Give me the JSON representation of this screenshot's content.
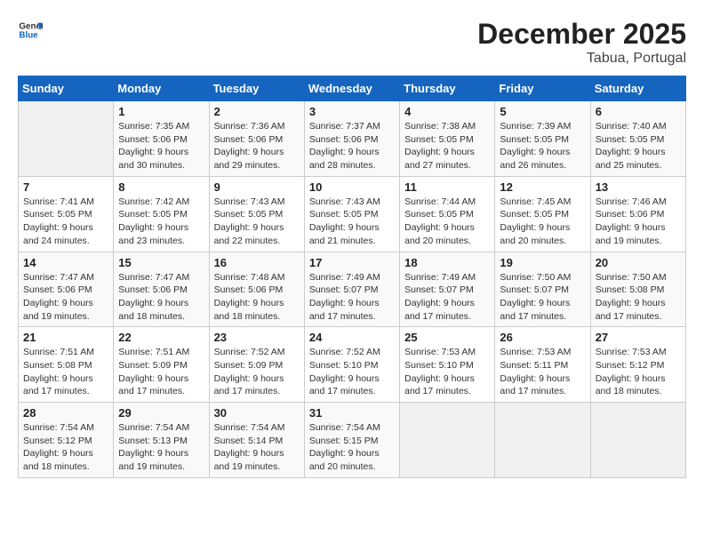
{
  "header": {
    "logo_line1": "General",
    "logo_line2": "Blue",
    "month": "December 2025",
    "location": "Tabua, Portugal"
  },
  "days_of_week": [
    "Sunday",
    "Monday",
    "Tuesday",
    "Wednesday",
    "Thursday",
    "Friday",
    "Saturday"
  ],
  "weeks": [
    [
      {
        "day": "",
        "info": ""
      },
      {
        "day": "1",
        "info": "Sunrise: 7:35 AM\nSunset: 5:06 PM\nDaylight: 9 hours\nand 30 minutes."
      },
      {
        "day": "2",
        "info": "Sunrise: 7:36 AM\nSunset: 5:06 PM\nDaylight: 9 hours\nand 29 minutes."
      },
      {
        "day": "3",
        "info": "Sunrise: 7:37 AM\nSunset: 5:06 PM\nDaylight: 9 hours\nand 28 minutes."
      },
      {
        "day": "4",
        "info": "Sunrise: 7:38 AM\nSunset: 5:05 PM\nDaylight: 9 hours\nand 27 minutes."
      },
      {
        "day": "5",
        "info": "Sunrise: 7:39 AM\nSunset: 5:05 PM\nDaylight: 9 hours\nand 26 minutes."
      },
      {
        "day": "6",
        "info": "Sunrise: 7:40 AM\nSunset: 5:05 PM\nDaylight: 9 hours\nand 25 minutes."
      }
    ],
    [
      {
        "day": "7",
        "info": "Sunrise: 7:41 AM\nSunset: 5:05 PM\nDaylight: 9 hours\nand 24 minutes."
      },
      {
        "day": "8",
        "info": "Sunrise: 7:42 AM\nSunset: 5:05 PM\nDaylight: 9 hours\nand 23 minutes."
      },
      {
        "day": "9",
        "info": "Sunrise: 7:43 AM\nSunset: 5:05 PM\nDaylight: 9 hours\nand 22 minutes."
      },
      {
        "day": "10",
        "info": "Sunrise: 7:43 AM\nSunset: 5:05 PM\nDaylight: 9 hours\nand 21 minutes."
      },
      {
        "day": "11",
        "info": "Sunrise: 7:44 AM\nSunset: 5:05 PM\nDaylight: 9 hours\nand 20 minutes."
      },
      {
        "day": "12",
        "info": "Sunrise: 7:45 AM\nSunset: 5:05 PM\nDaylight: 9 hours\nand 20 minutes."
      },
      {
        "day": "13",
        "info": "Sunrise: 7:46 AM\nSunset: 5:06 PM\nDaylight: 9 hours\nand 19 minutes."
      }
    ],
    [
      {
        "day": "14",
        "info": "Sunrise: 7:47 AM\nSunset: 5:06 PM\nDaylight: 9 hours\nand 19 minutes."
      },
      {
        "day": "15",
        "info": "Sunrise: 7:47 AM\nSunset: 5:06 PM\nDaylight: 9 hours\nand 18 minutes."
      },
      {
        "day": "16",
        "info": "Sunrise: 7:48 AM\nSunset: 5:06 PM\nDaylight: 9 hours\nand 18 minutes."
      },
      {
        "day": "17",
        "info": "Sunrise: 7:49 AM\nSunset: 5:07 PM\nDaylight: 9 hours\nand 17 minutes."
      },
      {
        "day": "18",
        "info": "Sunrise: 7:49 AM\nSunset: 5:07 PM\nDaylight: 9 hours\nand 17 minutes."
      },
      {
        "day": "19",
        "info": "Sunrise: 7:50 AM\nSunset: 5:07 PM\nDaylight: 9 hours\nand 17 minutes."
      },
      {
        "day": "20",
        "info": "Sunrise: 7:50 AM\nSunset: 5:08 PM\nDaylight: 9 hours\nand 17 minutes."
      }
    ],
    [
      {
        "day": "21",
        "info": "Sunrise: 7:51 AM\nSunset: 5:08 PM\nDaylight: 9 hours\nand 17 minutes."
      },
      {
        "day": "22",
        "info": "Sunrise: 7:51 AM\nSunset: 5:09 PM\nDaylight: 9 hours\nand 17 minutes."
      },
      {
        "day": "23",
        "info": "Sunrise: 7:52 AM\nSunset: 5:09 PM\nDaylight: 9 hours\nand 17 minutes."
      },
      {
        "day": "24",
        "info": "Sunrise: 7:52 AM\nSunset: 5:10 PM\nDaylight: 9 hours\nand 17 minutes."
      },
      {
        "day": "25",
        "info": "Sunrise: 7:53 AM\nSunset: 5:10 PM\nDaylight: 9 hours\nand 17 minutes."
      },
      {
        "day": "26",
        "info": "Sunrise: 7:53 AM\nSunset: 5:11 PM\nDaylight: 9 hours\nand 17 minutes."
      },
      {
        "day": "27",
        "info": "Sunrise: 7:53 AM\nSunset: 5:12 PM\nDaylight: 9 hours\nand 18 minutes."
      }
    ],
    [
      {
        "day": "28",
        "info": "Sunrise: 7:54 AM\nSunset: 5:12 PM\nDaylight: 9 hours\nand 18 minutes."
      },
      {
        "day": "29",
        "info": "Sunrise: 7:54 AM\nSunset: 5:13 PM\nDaylight: 9 hours\nand 19 minutes."
      },
      {
        "day": "30",
        "info": "Sunrise: 7:54 AM\nSunset: 5:14 PM\nDaylight: 9 hours\nand 19 minutes."
      },
      {
        "day": "31",
        "info": "Sunrise: 7:54 AM\nSunset: 5:15 PM\nDaylight: 9 hours\nand 20 minutes."
      },
      {
        "day": "",
        "info": ""
      },
      {
        "day": "",
        "info": ""
      },
      {
        "day": "",
        "info": ""
      }
    ]
  ]
}
